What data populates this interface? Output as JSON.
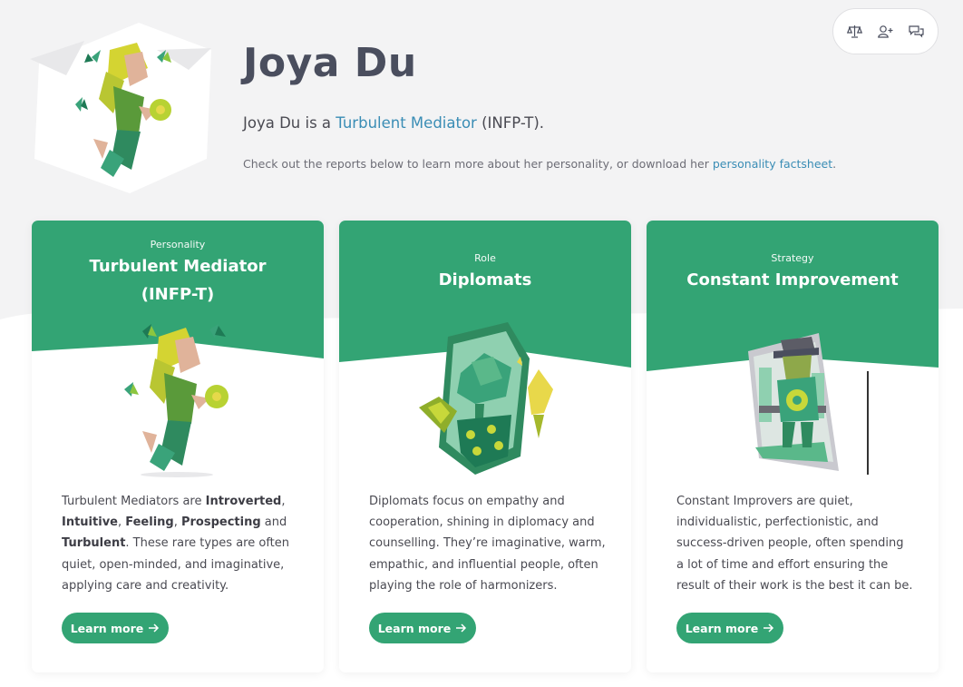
{
  "profile": {
    "name": "Joya Du",
    "intro_prefix": "Joya Du is a ",
    "intro_link": "Turbulent Mediator",
    "intro_suffix": " (INFP-T).",
    "sub_prefix": "Check out the reports below to learn more about her personality, or download her ",
    "sub_link": "personality factsheet",
    "sub_suffix": "."
  },
  "actions": [
    {
      "icon": "compare-scale-icon"
    },
    {
      "icon": "add-friend-icon"
    },
    {
      "icon": "chat-icon"
    }
  ],
  "colors": {
    "accent": "#33a474",
    "link": "#3a8db5",
    "heading": "#4a4e5e"
  },
  "cards": [
    {
      "kicker": "Personality",
      "title_line1": "Turbulent Mediator",
      "title_line2": "(INFP-T)",
      "body": [
        {
          "t": "Turbulent Mediators are ",
          "b": false
        },
        {
          "t": "Introverted",
          "b": true
        },
        {
          "t": ", ",
          "b": false
        },
        {
          "t": "Intuitive",
          "b": true
        },
        {
          "t": ", ",
          "b": false
        },
        {
          "t": "Feeling",
          "b": true
        },
        {
          "t": ", ",
          "b": false
        },
        {
          "t": "Prospecting",
          "b": true
        },
        {
          "t": " and ",
          "b": false
        },
        {
          "t": "Turbulent",
          "b": true
        },
        {
          "t": ". These rare types are often quiet, open-minded, and imaginative, applying care and creativity.",
          "b": false
        }
      ],
      "button": "Learn more"
    },
    {
      "kicker": "Role",
      "title_line1": "Diplomats",
      "body_text": "Diplomats focus on empathy and cooperation, shining in diplomacy and counselling. They’re imaginative, warm, empathic, and influential people, often playing the role of harmonizers.",
      "button": "Learn more"
    },
    {
      "kicker": "Strategy",
      "title_line1": "Constant Improvement",
      "body_text": "Constant Improvers are quiet, individualistic, perfectionistic, and success-driven people, often spending a lot of time and effort ensuring the result of their work is the best it can be.",
      "button": "Learn more"
    }
  ]
}
